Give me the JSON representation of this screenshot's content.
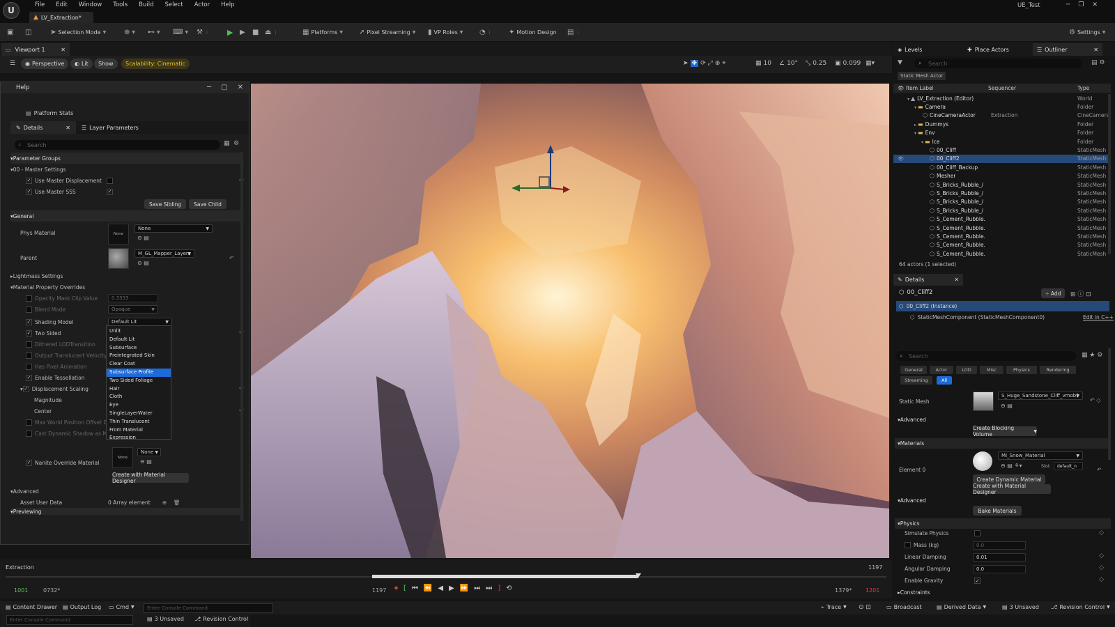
{
  "menubar": {
    "items": [
      "File",
      "Edit",
      "Window",
      "Tools",
      "Build",
      "Select",
      "Actor",
      "Help"
    ],
    "map_tab": "LV_Extraction*",
    "project": "UE_Test"
  },
  "toolbar": {
    "selection_mode": "Selection Mode",
    "platforms": "Platforms",
    "pixel_streaming": "Pixel Streaming",
    "vp_roles": "VP Roles",
    "motion_design": "Motion Design",
    "settings": "Settings"
  },
  "viewport": {
    "tab": "Viewport 1",
    "perspective": "Perspective",
    "lit": "Lit",
    "show": "Show",
    "scalability": "Scalability: Cinematic",
    "grid": "10",
    "angle": "10°",
    "scale": "0.25",
    "cam_speed": "0.099"
  },
  "help_panel": {
    "title": "Help",
    "platform_stats": "Platform Stats"
  },
  "details": {
    "tab": "Details",
    "tab2": "Layer Parameters",
    "search": "Search",
    "parameter_groups": "Parameter Groups",
    "master_settings": "00 - Master Settings",
    "use_master_displacement": "Use Master Displacement",
    "use_master_sss": "Use Master SSS",
    "save_sibling": "Save Sibling",
    "save_child": "Save Child",
    "general": "General",
    "phys_material": "Phys Material",
    "none": "None",
    "thumb_none": "None",
    "parent": "Parent",
    "parent_value": "M_GL_Mapper_Layers",
    "lightmass": "Lightmass Settings",
    "overrides": "Material Property Overrides",
    "opacity_mask": "Opacity Mask Clip Value",
    "opacity_value": "0.3333",
    "blend_mode": "Blend Mode",
    "blend_value": "Opaque",
    "shading_model": "Shading Model",
    "shading_value": "Default Lit",
    "two_sided": "Two Sided",
    "dithered": "Dithered LODTransition",
    "output_velocity": "Output Translucent Velocity",
    "max_pixel": "Has Pixel Animation",
    "enable_tess": "Enable Tessellation",
    "disp_scaling": "Displacement Scaling",
    "magnitude": "Magnitude",
    "center": "Center",
    "max_world": "Max World Position Offset D...",
    "cast_shadow": "Cast Dynamic Shadow as M...",
    "nanite_override": "Nanite Override Material",
    "create_designer": "Create with Material Designer",
    "advanced": "Advanced",
    "asset_user_data": "Asset User Data",
    "array_element": "0 Array element",
    "previewing": "Previewing"
  },
  "shading_dropdown": [
    "Unlit",
    "Default Lit",
    "Subsurface",
    "Preintegrated Skin",
    "Clear Coat",
    "Subsurface Profile",
    "Two Sided Foliage",
    "Hair",
    "Cloth",
    "Eye",
    "SingleLayerWater",
    "Thin Translucent",
    "From Material Expression"
  ],
  "help_footer": {
    "console": "Enter Console Command",
    "unsaved": "3 Unsaved",
    "revision": "Revision Control"
  },
  "outliner": {
    "tabs": [
      "Levels",
      "Place Actors",
      "Outliner"
    ],
    "search": "Search",
    "filter_chip": "Static Mesh Actor",
    "col_label": "Item Label",
    "col_seq": "Sequencer",
    "col_type": "Type",
    "rows": [
      {
        "label": "LV_Extraction (Editor)",
        "type": "World",
        "seq": "",
        "indent": 1,
        "kind": "world"
      },
      {
        "label": "Camera",
        "type": "Folder",
        "seq": "",
        "indent": 2,
        "kind": "folder"
      },
      {
        "label": "CineCameraActor",
        "type": "CineCamera",
        "seq": "Extraction",
        "indent": 3,
        "kind": "mesh"
      },
      {
        "label": "Dummys",
        "type": "Folder",
        "seq": "",
        "indent": 2,
        "kind": "folder"
      },
      {
        "label": "Env",
        "type": "Folder",
        "seq": "",
        "indent": 2,
        "kind": "folder"
      },
      {
        "label": "Ice",
        "type": "Folder",
        "seq": "",
        "indent": 3,
        "kind": "folder"
      },
      {
        "label": "00_Cliff",
        "type": "StaticMesh",
        "seq": "",
        "indent": 4,
        "kind": "mesh"
      },
      {
        "label": "00_Cliff2",
        "type": "StaticMesh",
        "seq": "",
        "indent": 4,
        "kind": "mesh",
        "selected": true
      },
      {
        "label": "00_Cliff_Backup",
        "type": "StaticMesh",
        "seq": "",
        "indent": 4,
        "kind": "mesh"
      },
      {
        "label": "Mesher",
        "type": "StaticMesh",
        "seq": "",
        "indent": 4,
        "kind": "mesh"
      },
      {
        "label": "S_Bricks_Rubble_/",
        "type": "StaticMesh",
        "seq": "",
        "indent": 4,
        "kind": "mesh"
      },
      {
        "label": "S_Bricks_Rubble_/",
        "type": "StaticMesh",
        "seq": "",
        "indent": 4,
        "kind": "mesh"
      },
      {
        "label": "S_Bricks_Rubble_/",
        "type": "StaticMesh",
        "seq": "",
        "indent": 4,
        "kind": "mesh"
      },
      {
        "label": "S_Bricks_Rubble_/",
        "type": "StaticMesh",
        "seq": "",
        "indent": 4,
        "kind": "mesh"
      },
      {
        "label": "S_Cement_Rubble.",
        "type": "StaticMesh",
        "seq": "",
        "indent": 4,
        "kind": "mesh"
      },
      {
        "label": "S_Cement_Rubble.",
        "type": "StaticMesh",
        "seq": "",
        "indent": 4,
        "kind": "mesh"
      },
      {
        "label": "S_Cement_Rubble.",
        "type": "StaticMesh",
        "seq": "",
        "indent": 4,
        "kind": "mesh"
      },
      {
        "label": "S_Cement_Rubble.",
        "type": "StaticMesh",
        "seq": "",
        "indent": 4,
        "kind": "mesh"
      },
      {
        "label": "S_Cement_Rubble.",
        "type": "StaticMesh",
        "seq": "",
        "indent": 4,
        "kind": "mesh"
      }
    ],
    "count": "64 actors (1 selected)"
  },
  "rdetails": {
    "tab": "Details",
    "actor": "00_Cliff2",
    "add": "Add",
    "instance": "00_Cliff2 (Instance)",
    "component": "StaticMeshComponent (StaticMeshComponent0)",
    "edit_cpp": "Edit in C++",
    "search": "Search",
    "filters": [
      "General",
      "Actor",
      "LOD",
      "Misc",
      "Physics",
      "Rendering",
      "Streaming",
      "All"
    ],
    "static_mesh": "Static Mesh",
    "mesh_value": "S_Huge_Sandstone_Cliff_vmobf",
    "advanced": "Advanced",
    "blocking": "Create Blocking Volume",
    "materials": "Materials",
    "element0": "Element 0",
    "mat_value": "MI_Snow_Material",
    "slot": "Slot",
    "slot_value": "default_n",
    "dyn_mat": "Create Dynamic Material",
    "designer": "Create with Material Designer",
    "bake": "Bake Materials",
    "physics": "Physics",
    "sim_phys": "Simulate Physics",
    "mass": "Mass (kg)",
    "mass_value": "0.0",
    "lin_damp": "Linear Damping",
    "lin_value": "0.01",
    "ang_damp": "Angular Damping",
    "ang_value": "0.0",
    "gravity": "Enable Gravity",
    "constraints": "Constraints"
  },
  "sequencer": {
    "name": "Extraction",
    "frame_end": "1197",
    "start": "1001",
    "playhead": "0732*",
    "current": "1197",
    "end_a": "1379*",
    "end_b": "1201"
  },
  "bottom": {
    "content_drawer": "Content Drawer",
    "output_log": "Output Log",
    "cmd": "Cmd",
    "console": "Enter Console Command",
    "trace": "Trace",
    "broadcast": "Broadcast",
    "derived": "Derived Data",
    "unsaved": "3 Unsaved",
    "revision": "Revision Control"
  }
}
